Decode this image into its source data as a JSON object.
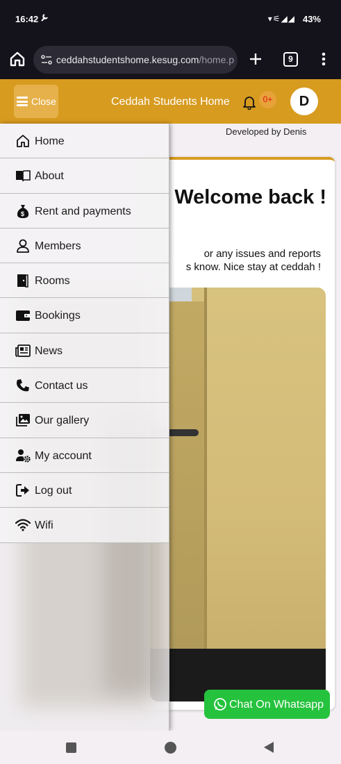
{
  "status_bar": {
    "time": "16:42",
    "signal_icons": "▾⚟◢◢",
    "battery": "43%"
  },
  "browser": {
    "url_main": "ceddahstudentshome.kesug.com",
    "url_rest": "/home.p",
    "tab_count": "9"
  },
  "header": {
    "close_label": "Close",
    "title": "Ceddah Students Home",
    "notification_count": "0+",
    "avatar_letter": "D"
  },
  "page": {
    "credit": "Developed by Denis",
    "welcome": "Welcome back !",
    "message_line1": "or any issues and reports",
    "message_line2": "s know. Nice stay at ceddah !"
  },
  "whatsapp": {
    "label": "Chat On Whatsapp"
  },
  "sidebar": {
    "items": [
      {
        "label": "Home",
        "icon": "home-icon"
      },
      {
        "label": "About",
        "icon": "book-icon"
      },
      {
        "label": "Rent and payments",
        "icon": "money-bag-icon"
      },
      {
        "label": "Members",
        "icon": "user-icon"
      },
      {
        "label": "Rooms",
        "icon": "door-icon"
      },
      {
        "label": "Bookings",
        "icon": "wallet-icon"
      },
      {
        "label": "News",
        "icon": "newspaper-icon"
      },
      {
        "label": "Contact us",
        "icon": "phone-icon"
      },
      {
        "label": "Our gallery",
        "icon": "gallery-icon"
      },
      {
        "label": "My account",
        "icon": "user-gear-icon"
      },
      {
        "label": "Log out",
        "icon": "logout-icon"
      },
      {
        "label": "Wifi",
        "icon": "wifi-icon"
      }
    ]
  },
  "colors": {
    "accent": "#d79b1f",
    "whatsapp": "#25c23d",
    "status_bg": "#14131c"
  }
}
